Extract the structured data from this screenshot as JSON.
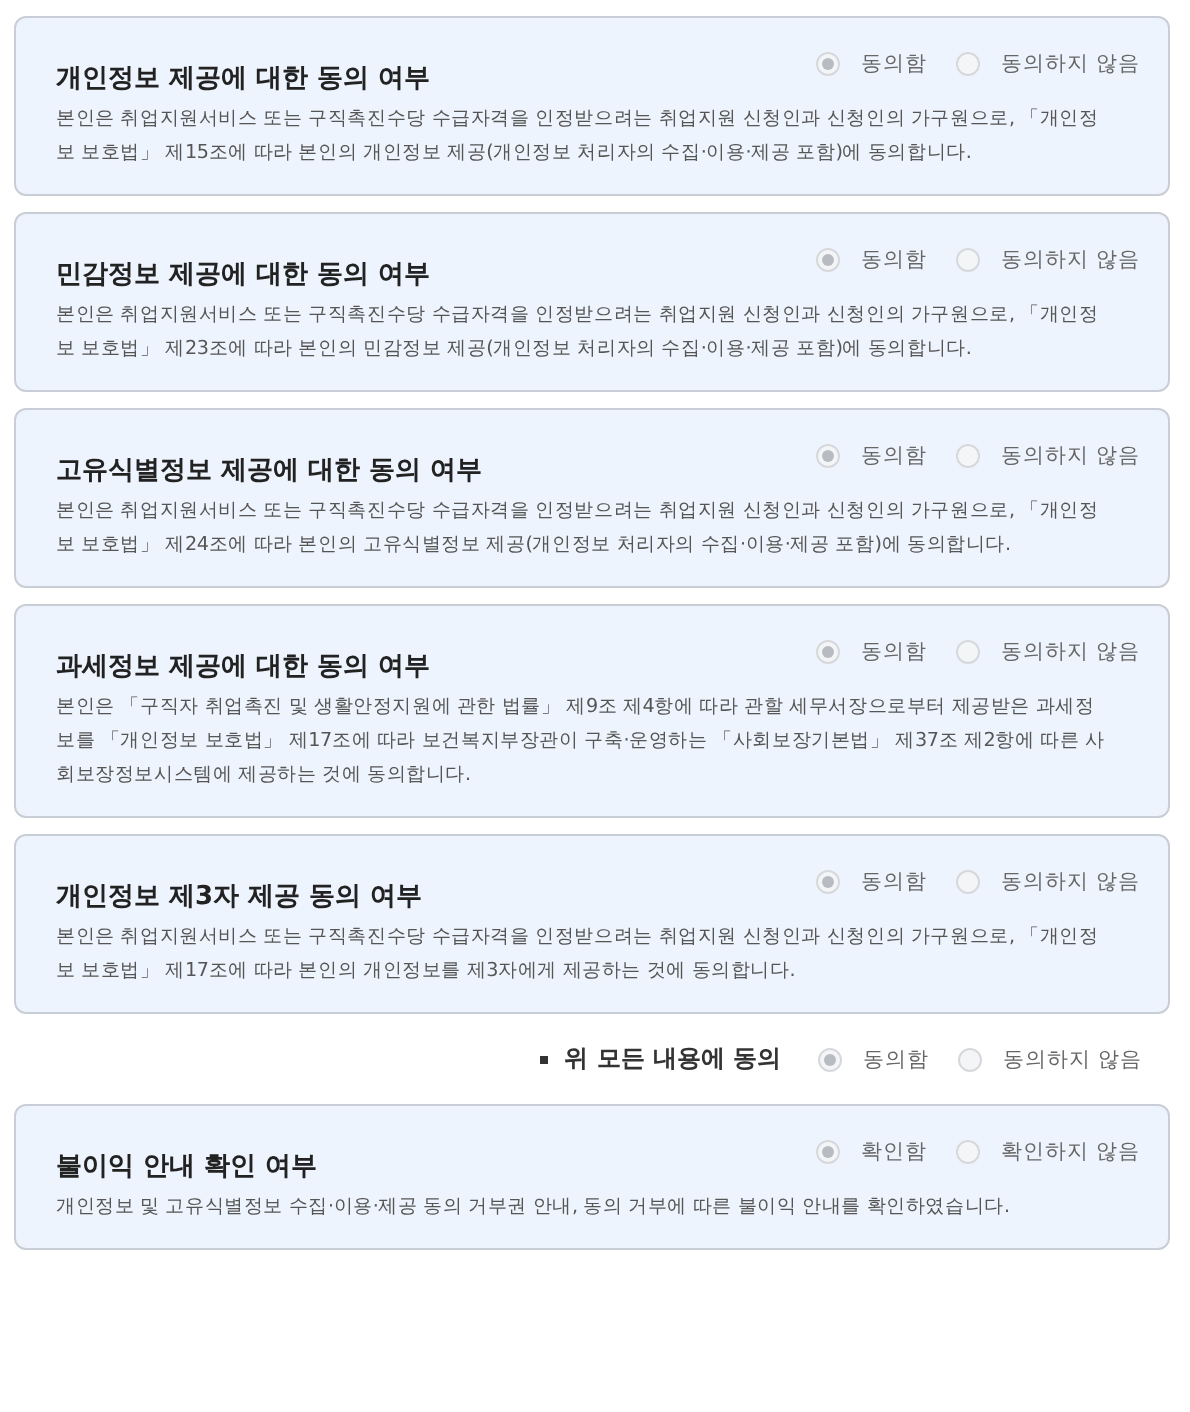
{
  "sections": [
    {
      "title": "개인정보 제공에 대한 동의 여부",
      "text": "본인은 취업지원서비스 또는 구직촉진수당 수급자격을 인정받으려는 취업지원 신청인과 신청인의 가구원으로, 「개인정보 보호법」 제15조에 따라 본인의 개인정보 제공(개인정보 처리자의 수집·이용·제공 포함)에 동의합니다.",
      "disabled": true,
      "options": [
        {
          "label": "동의함",
          "selected": true
        },
        {
          "label": "동의하지 않음",
          "selected": false
        }
      ]
    },
    {
      "title": "민감정보 제공에 대한 동의 여부",
      "text": "본인은 취업지원서비스 또는 구직촉진수당 수급자격을 인정받으려는 취업지원 신청인과 신청인의 가구원으로, 「개인정보 보호법」 제23조에 따라 본인의 민감정보 제공(개인정보 처리자의 수집·이용·제공 포함)에 동의합니다.",
      "disabled": true,
      "options": [
        {
          "label": "동의함",
          "selected": true
        },
        {
          "label": "동의하지 않음",
          "selected": false
        }
      ]
    },
    {
      "title": "고유식별정보 제공에 대한 동의 여부",
      "text": "본인은 취업지원서비스 또는 구직촉진수당 수급자격을 인정받으려는 취업지원 신청인과 신청인의 가구원으로, 「개인정보 보호법」 제24조에 따라 본인의 고유식별정보 제공(개인정보 처리자의 수집·이용·제공 포함)에 동의합니다.",
      "disabled": true,
      "options": [
        {
          "label": "동의함",
          "selected": true
        },
        {
          "label": "동의하지 않음",
          "selected": false
        }
      ]
    },
    {
      "title": "과세정보 제공에 대한 동의 여부",
      "text": "본인은 「구직자 취업촉진 및 생활안정지원에 관한 법률」 제9조 제4항에 따라 관할 세무서장으로부터 제공받은 과세정보를 「개인정보 보호법」 제17조에 따라 보건복지부장관이 구축·운영하는 「사회보장기본법」 제37조 제2항에 따른 사회보장정보시스템에 제공하는 것에 동의합니다.",
      "disabled": true,
      "options": [
        {
          "label": "동의함",
          "selected": true
        },
        {
          "label": "동의하지 않음",
          "selected": false
        }
      ]
    },
    {
      "title": "개인정보 제3자 제공 동의 여부",
      "text": "본인은 취업지원서비스 또는 구직촉진수당 수급자격을 인정받으려는 취업지원 신청인과 신청인의 가구원으로, 「개인정보 보호법」 제17조에 따라 본인의 개인정보를 제3자에게 제공하는 것에 동의합니다.",
      "disabled": true,
      "options": [
        {
          "label": "동의함",
          "selected": true
        },
        {
          "label": "동의하지 않음",
          "selected": false
        }
      ]
    }
  ],
  "agree_all": {
    "label": "위 모든 내용에 동의",
    "disabled": true,
    "options": [
      {
        "label": "동의함",
        "selected": true
      },
      {
        "label": "동의하지 않음",
        "selected": false
      }
    ]
  },
  "disadvantage": {
    "title": "불이익 안내 확인 여부",
    "text": "개인정보 및 고유식별정보 수집·이용·제공 동의 거부권 안내, 동의 거부에 따른 불이익 안내를 확인하였습니다.",
    "disabled": true,
    "options": [
      {
        "label": "확인함",
        "selected": true
      },
      {
        "label": "확인하지 않음",
        "selected": false
      }
    ]
  }
}
